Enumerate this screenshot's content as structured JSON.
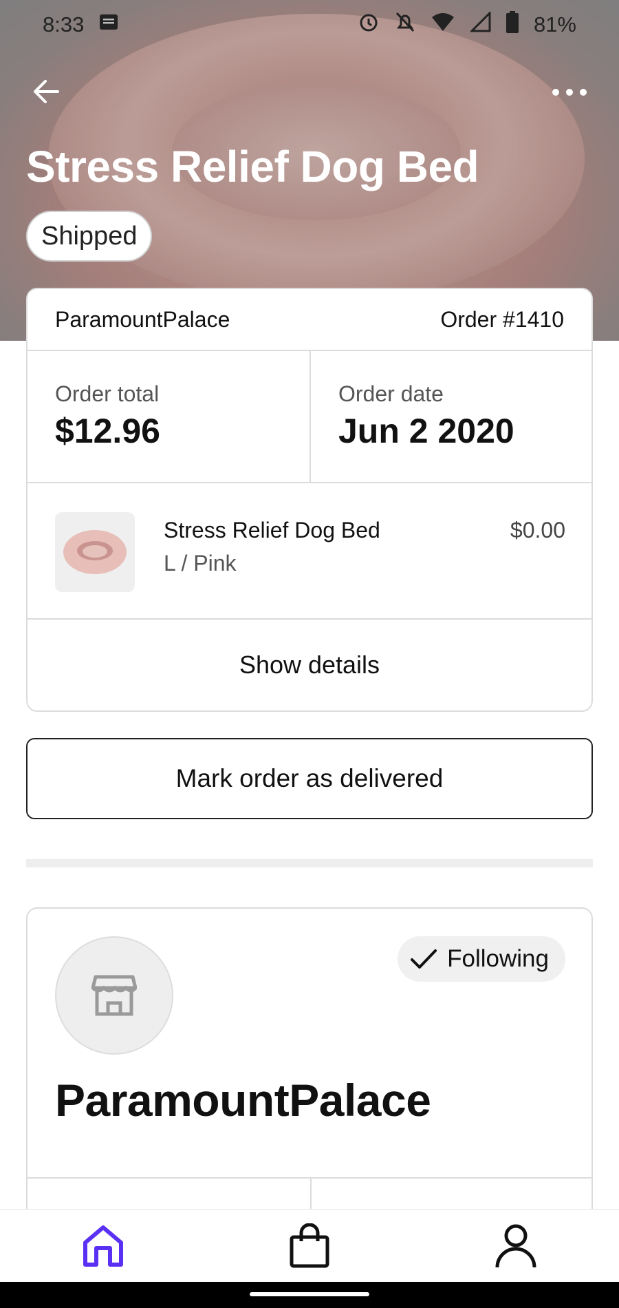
{
  "status_bar": {
    "time": "8:33",
    "battery": "81%",
    "icons": [
      "message-icon",
      "alarm-icon",
      "notifications-off-icon",
      "wifi-icon",
      "signal-icon",
      "battery-icon"
    ]
  },
  "header": {
    "title": "Stress Relief Dog Bed",
    "status_chip": "Shipped",
    "back_icon": "arrow-left-icon",
    "more_icon": "more-horizontal-icon"
  },
  "order": {
    "shop_name": "ParamountPalace",
    "order_number": "Order #1410",
    "total_label": "Order total",
    "total_value": "$12.96",
    "date_label": "Order date",
    "date_value": "Jun 2 2020",
    "item": {
      "name": "Stress Relief Dog Bed",
      "variant": "L / Pink",
      "price": "$0.00"
    },
    "show_details_label": "Show details"
  },
  "actions": {
    "mark_delivered_label": "Mark order as delivered"
  },
  "shop": {
    "name": "ParamountPalace",
    "follow_label": "Following",
    "avatar_icon": "storefront-icon"
  },
  "bottom_nav": {
    "items": [
      "home-icon",
      "shopping-bag-icon",
      "account-icon"
    ],
    "active": "home-icon",
    "accent_color": "#5a31f4"
  }
}
